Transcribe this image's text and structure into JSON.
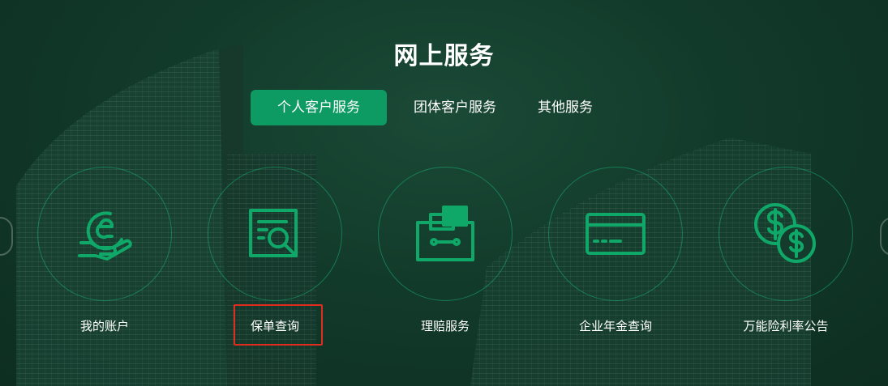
{
  "page": {
    "title": "网上服务"
  },
  "tabs": [
    {
      "label": "个人客户服务",
      "active": true
    },
    {
      "label": "团体客户服务",
      "active": false
    },
    {
      "label": "其他服务",
      "active": false
    }
  ],
  "services": [
    {
      "label": "我的账户",
      "icon": "account-hand-e-icon"
    },
    {
      "label": "保单查询",
      "icon": "policy-search-icon"
    },
    {
      "label": "理赔服务",
      "icon": "claims-folder-icon"
    },
    {
      "label": "企业年金查询",
      "icon": "card-icon"
    },
    {
      "label": "万能险利率公告",
      "icon": "dollar-coins-icon"
    }
  ],
  "colors": {
    "accent": "#0d9a63",
    "icon": "#0fa869",
    "highlight_box": "#e02d1f",
    "background": "#123a2a"
  }
}
